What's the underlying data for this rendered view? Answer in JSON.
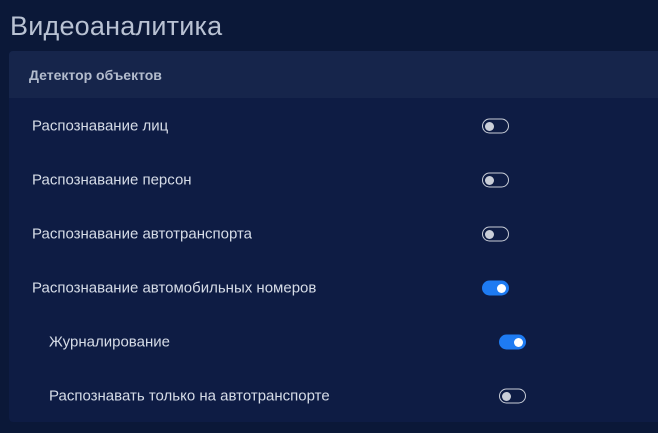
{
  "page": {
    "title": "Видеоаналитика"
  },
  "panel": {
    "title": "Детектор объектов",
    "settings": [
      {
        "label": "Распознавание лиц",
        "enabled": false
      },
      {
        "label": "Распознавание персон",
        "enabled": false
      },
      {
        "label": "Распознавание автотранспорта",
        "enabled": false
      },
      {
        "label": "Распознавание автомобильных номеров",
        "enabled": true
      },
      {
        "label": "Журналирование",
        "enabled": true
      },
      {
        "label": "Распознавать только на автотранспорте",
        "enabled": false
      }
    ]
  },
  "colors": {
    "background": "#0b1838",
    "panel": "#0e1c44",
    "panel_header": "#16254b",
    "toggle_on": "#1e7bf2",
    "toggle_off": "#c9ced8",
    "text": "#d6dce7"
  }
}
